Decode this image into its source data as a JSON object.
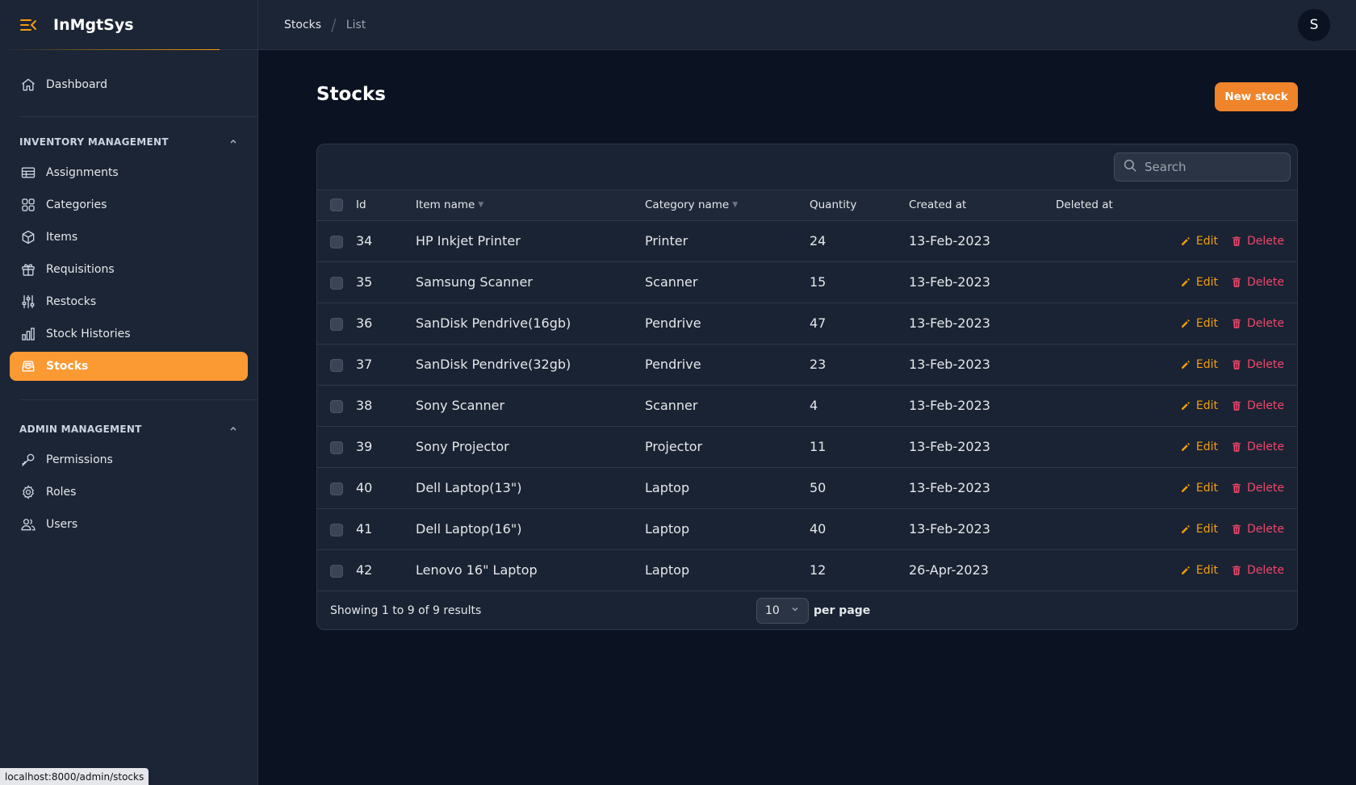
{
  "app": {
    "title": "InMgtSys"
  },
  "sidebar": {
    "dashboard": "Dashboard",
    "groups": [
      {
        "title": "INVENTORY MANAGEMENT",
        "items": [
          {
            "label": "Assignments",
            "icon": "table-icon"
          },
          {
            "label": "Categories",
            "icon": "grid-icon"
          },
          {
            "label": "Items",
            "icon": "cube-icon"
          },
          {
            "label": "Requisitions",
            "icon": "gift-icon"
          },
          {
            "label": "Restocks",
            "icon": "sliders-icon"
          },
          {
            "label": "Stock Histories",
            "icon": "bar-chart-icon"
          },
          {
            "label": "Stocks",
            "icon": "inbox-icon",
            "active": true
          }
        ]
      },
      {
        "title": "ADMIN MANAGEMENT",
        "items": [
          {
            "label": "Permissions",
            "icon": "key-icon"
          },
          {
            "label": "Roles",
            "icon": "gear-icon"
          },
          {
            "label": "Users",
            "icon": "users-icon"
          }
        ]
      }
    ]
  },
  "breadcrumb": {
    "root": "Stocks",
    "current": "List"
  },
  "user": {
    "initial": "S"
  },
  "page": {
    "title": "Stocks",
    "new_button": "New stock"
  },
  "search": {
    "placeholder": "Search"
  },
  "table": {
    "columns": {
      "id": "Id",
      "item_name": "Item name",
      "category_name": "Category name",
      "quantity": "Quantity",
      "created_at": "Created at",
      "deleted_at": "Deleted at"
    },
    "edit_label": "Edit",
    "delete_label": "Delete",
    "rows": [
      {
        "id": "34",
        "item": "HP Inkjet Printer",
        "category": "Printer",
        "qty": "24",
        "created": "13-Feb-2023",
        "deleted": ""
      },
      {
        "id": "35",
        "item": "Samsung Scanner",
        "category": "Scanner",
        "qty": "15",
        "created": "13-Feb-2023",
        "deleted": ""
      },
      {
        "id": "36",
        "item": "SanDisk Pendrive(16gb)",
        "category": "Pendrive",
        "qty": "47",
        "created": "13-Feb-2023",
        "deleted": ""
      },
      {
        "id": "37",
        "item": "SanDisk Pendrive(32gb)",
        "category": "Pendrive",
        "qty": "23",
        "created": "13-Feb-2023",
        "deleted": ""
      },
      {
        "id": "38",
        "item": "Sony Scanner",
        "category": "Scanner",
        "qty": "4",
        "created": "13-Feb-2023",
        "deleted": ""
      },
      {
        "id": "39",
        "item": "Sony Projector",
        "category": "Projector",
        "qty": "11",
        "created": "13-Feb-2023",
        "deleted": ""
      },
      {
        "id": "40",
        "item": "Dell Laptop(13\")",
        "category": "Laptop",
        "qty": "50",
        "created": "13-Feb-2023",
        "deleted": ""
      },
      {
        "id": "41",
        "item": "Dell Laptop(16\")",
        "category": "Laptop",
        "qty": "40",
        "created": "13-Feb-2023",
        "deleted": ""
      },
      {
        "id": "42",
        "item": "Lenovo 16\" Laptop",
        "category": "Laptop",
        "qty": "12",
        "created": "26-Apr-2023",
        "deleted": ""
      }
    ]
  },
  "footer": {
    "summary": "Showing 1 to 9 of 9 results",
    "per_page_value": "10",
    "per_page_label": "per page"
  },
  "statusbar": {
    "url": "localhost:8000/admin/stocks"
  },
  "colors": {
    "accent": "#fb9a33",
    "edit": "#f59e0b",
    "delete": "#f0466b"
  }
}
